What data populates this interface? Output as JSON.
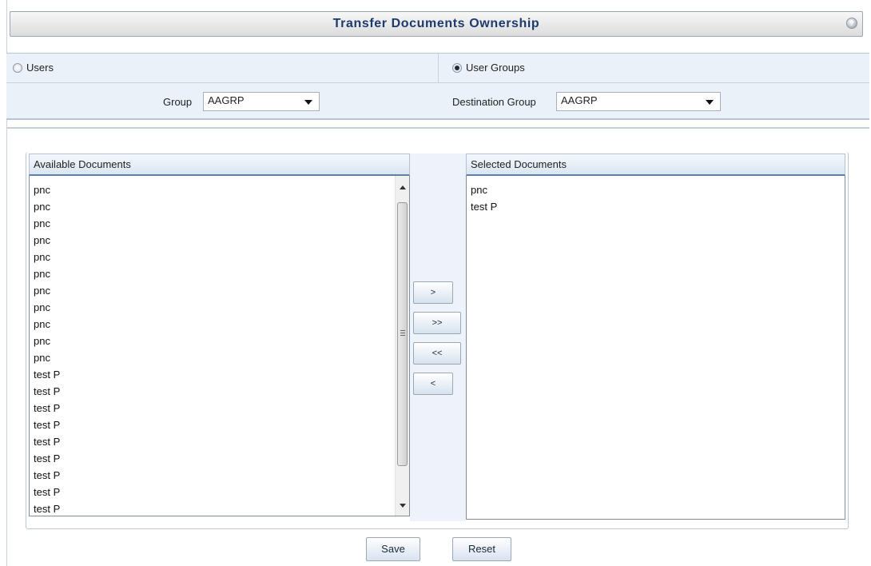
{
  "title": "Transfer Documents Ownership",
  "help_icon_glyph": "?",
  "owner_type": {
    "users_label": "Users",
    "user_groups_label": "User Groups",
    "selected": "User Groups"
  },
  "group": {
    "label": "Group",
    "value": "AAGRP"
  },
  "destination_group": {
    "label": "Destination Group",
    "value": "AAGRP"
  },
  "available": {
    "header": "Available Documents",
    "items": [
      "pnc",
      "pnc",
      "pnc",
      "pnc",
      "pnc",
      "pnc",
      "pnc",
      "pnc",
      "pnc",
      "pnc",
      "pnc",
      "test P",
      "test P",
      "test P",
      "test P",
      "test P",
      "test P",
      "test P",
      "test P",
      "test P"
    ]
  },
  "selected_docs": {
    "header": "Selected Documents",
    "items": [
      "pnc",
      "test P"
    ]
  },
  "move_buttons": {
    "add_one": ">",
    "add_all": ">>",
    "remove_all": "<<",
    "remove_one": "<"
  },
  "actions": {
    "save": "Save",
    "reset": "Reset"
  },
  "colors": {
    "title_text": "#1d3a6e",
    "row_background": "#eaf1f9",
    "header_underline": "#5f7fa3"
  }
}
